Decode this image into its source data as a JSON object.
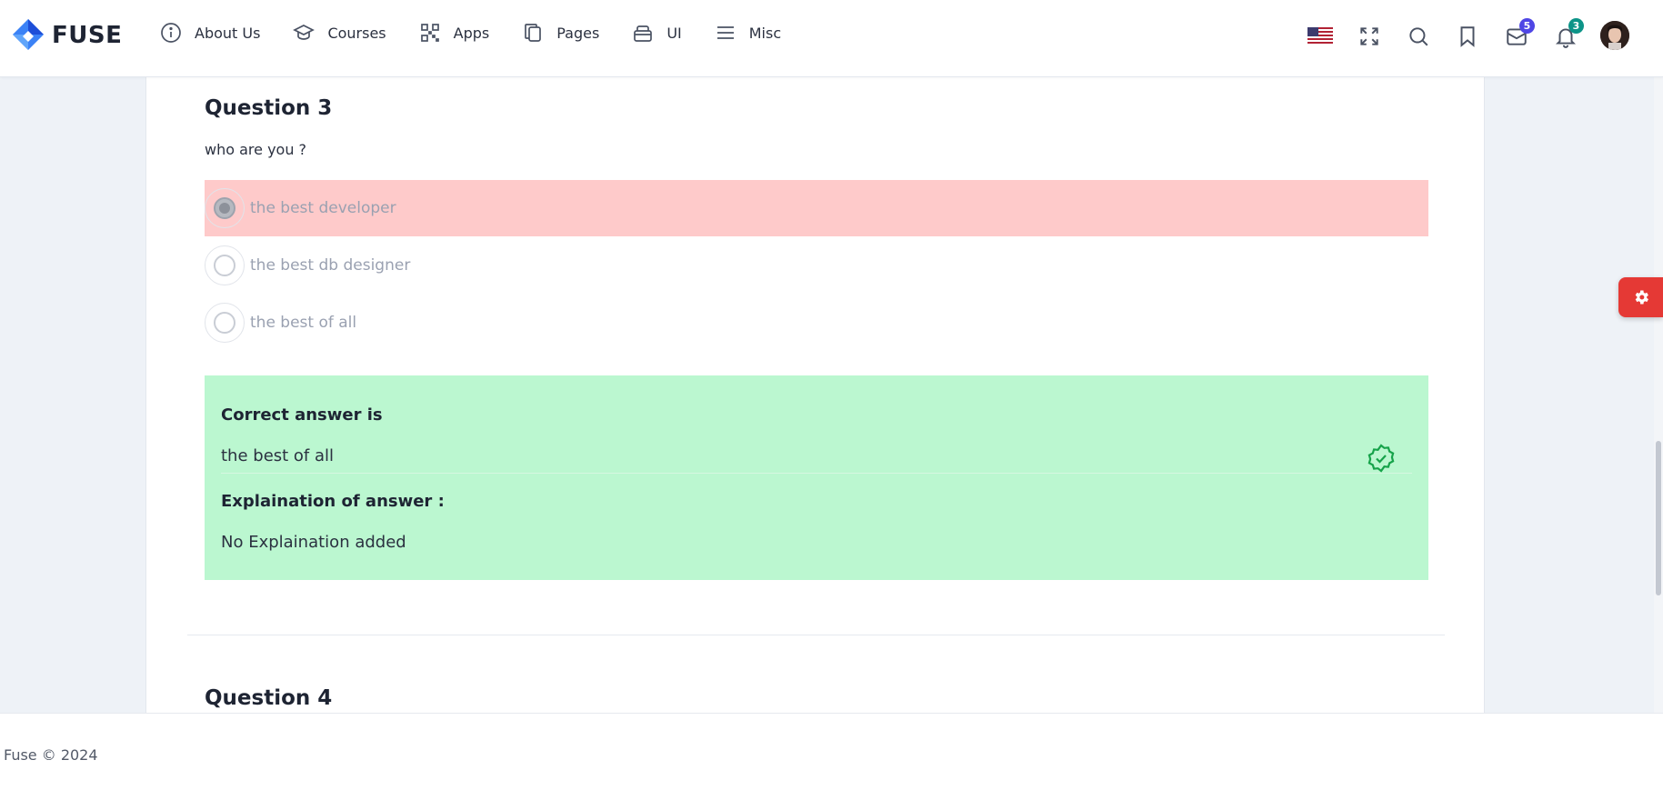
{
  "app": {
    "name": "FUSE"
  },
  "nav": {
    "items": [
      {
        "label": "About Us",
        "icon": "info-icon"
      },
      {
        "label": "Courses",
        "icon": "graduation-cap-icon"
      },
      {
        "label": "Apps",
        "icon": "qr-grid-icon"
      },
      {
        "label": "Pages",
        "icon": "copy-pages-icon"
      },
      {
        "label": "UI",
        "icon": "layers-box-icon"
      },
      {
        "label": "Misc",
        "icon": "menu-lines-icon"
      }
    ]
  },
  "header_actions": {
    "language": {
      "icon": "us-flag-icon"
    },
    "fullscreen": {
      "icon": "fullscreen-icon"
    },
    "search": {
      "icon": "search-icon"
    },
    "bookmark": {
      "icon": "bookmark-icon"
    },
    "messages": {
      "icon": "mail-icon",
      "count": "5",
      "color": "#4f46e5"
    },
    "notifications": {
      "icon": "bell-icon",
      "count": "3",
      "color": "#0d9488"
    },
    "avatar": {
      "icon": "user-avatar"
    }
  },
  "question3": {
    "title": "Question 3",
    "text": "who are you ?",
    "options": [
      {
        "label": "the best developer",
        "state": "selected-wrong"
      },
      {
        "label": "the best db designer",
        "state": "unselected"
      },
      {
        "label": "the best of all",
        "state": "unselected"
      }
    ],
    "answer": {
      "correct_heading": "Correct answer is",
      "correct_value": "the best of all",
      "explanation_heading": "Explaination of answer :",
      "explanation_value": "No Explaination added",
      "icon": "check-badge-icon"
    }
  },
  "question4": {
    "title": "Question 4"
  },
  "footer": {
    "text": "Fuse © 2024"
  },
  "colors": {
    "wrong_bg": "#fecaca",
    "correct_bg": "#bbf7d0",
    "settings_tab": "#e53935",
    "brand_blue": "#2f80ed"
  }
}
